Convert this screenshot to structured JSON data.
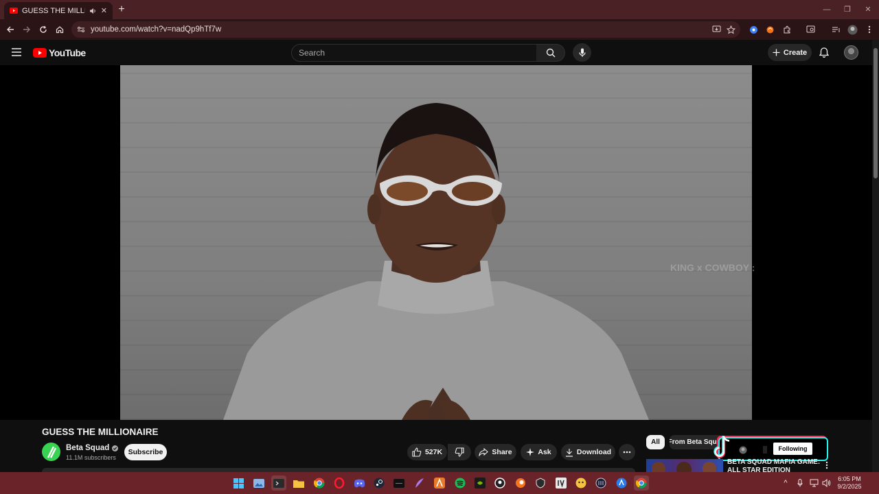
{
  "browser": {
    "tab_title": "GUESS THE MILLIONAIRE -",
    "new_tab": "+",
    "url": "youtube.com/watch?v=nadQp9hTf7w",
    "window_controls": [
      "—",
      "❐",
      "✕"
    ]
  },
  "youtube": {
    "logo_text": "YouTube",
    "search_placeholder": "Search",
    "create_label": "Create"
  },
  "player": {
    "overlay_text": "KING x COWBOY :"
  },
  "video": {
    "title": "GUESS THE MILLIONAIRE",
    "channel_name": "Beta Squad",
    "subscribers": "11.1M subscribers",
    "subscribe_label": "Subscribe",
    "like_count": "527K",
    "share_label": "Share",
    "ask_label": "Ask",
    "download_label": "Download"
  },
  "sidebar": {
    "chips": [
      "All",
      "From Beta Squad"
    ],
    "following_label": "Following",
    "rec_title_line1": "BETA SQUAD MAFIA GAME:",
    "rec_title_line2": "ALL STAR EDITION"
  },
  "taskbar": {
    "time": "6:05 PM",
    "date": "9/2/2025",
    "tray_chevron": "^"
  },
  "colors": {
    "tabbar": "#4a2226",
    "toolbar": "#2b1416",
    "youtube_red": "#ff0000",
    "page_bg": "#0f0f0f",
    "taskbar": "#6a2328",
    "channel_green": "#39d353"
  },
  "icons": {
    "tab": "youtube-favicon",
    "nav": [
      "back-arrow-icon",
      "forward-arrow-icon",
      "reload-icon",
      "home-icon"
    ],
    "masthead": [
      "hamburger-menu-icon",
      "search-icon",
      "microphone-icon",
      "bell-icon"
    ]
  }
}
